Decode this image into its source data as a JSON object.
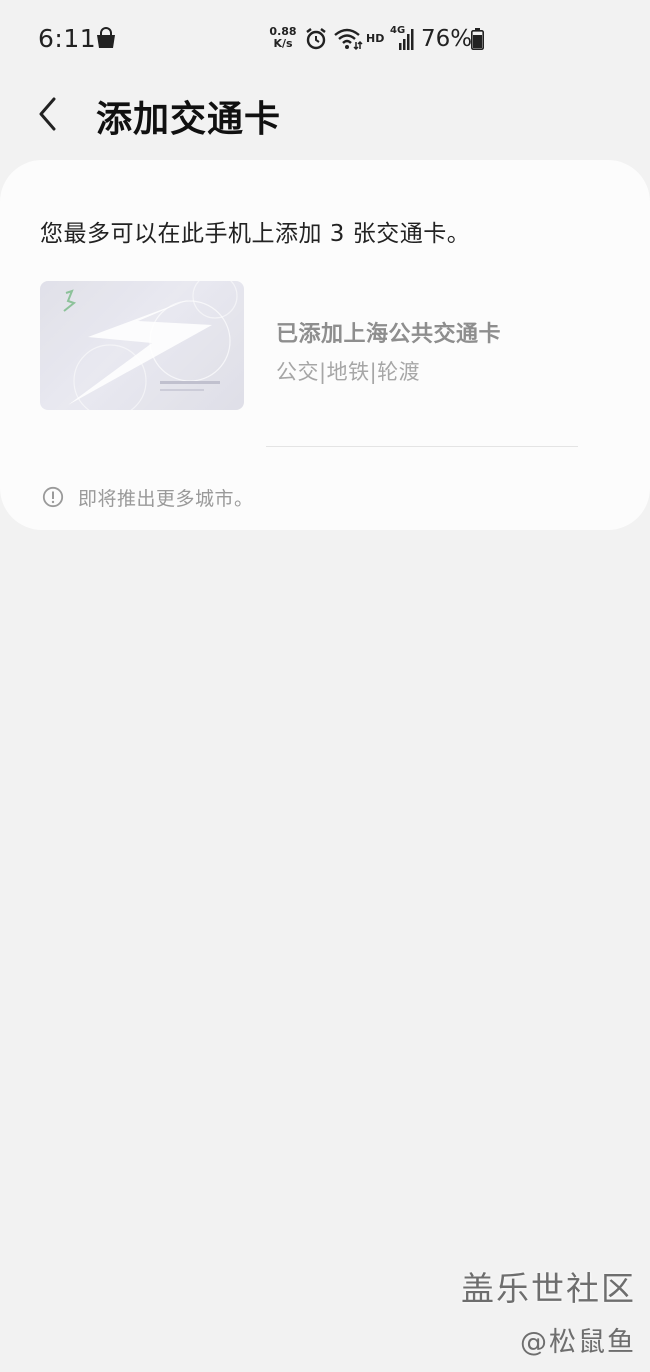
{
  "status_bar": {
    "time": "6:11",
    "net_speed_value": "0.88",
    "net_speed_unit": "K/s",
    "hd_label": "HD",
    "network_label": "4G",
    "battery_percent": "76%",
    "icons": [
      "shopping-bag-icon",
      "alarm-icon",
      "wifi-icon",
      "signal-icon",
      "battery-icon"
    ]
  },
  "header": {
    "back_icon": "chevron-left-icon",
    "title": "添加交通卡"
  },
  "card_section": {
    "limit_text": "您最多可以在此手机上添加 3 张交通卡。",
    "transit_cards": [
      {
        "name": "已添加上海公共交通卡",
        "modes": "公交|地铁|轮渡"
      }
    ],
    "notice_icon": "info-icon",
    "notice_text": "即将推出更多城市。"
  },
  "watermark": {
    "brand": "盖乐世社区",
    "author": "@松鼠鱼"
  },
  "colors": {
    "background": "#f2f2f2",
    "card": "#fcfcfc",
    "text_primary": "#222222",
    "text_disabled": "#8e8e8e"
  }
}
